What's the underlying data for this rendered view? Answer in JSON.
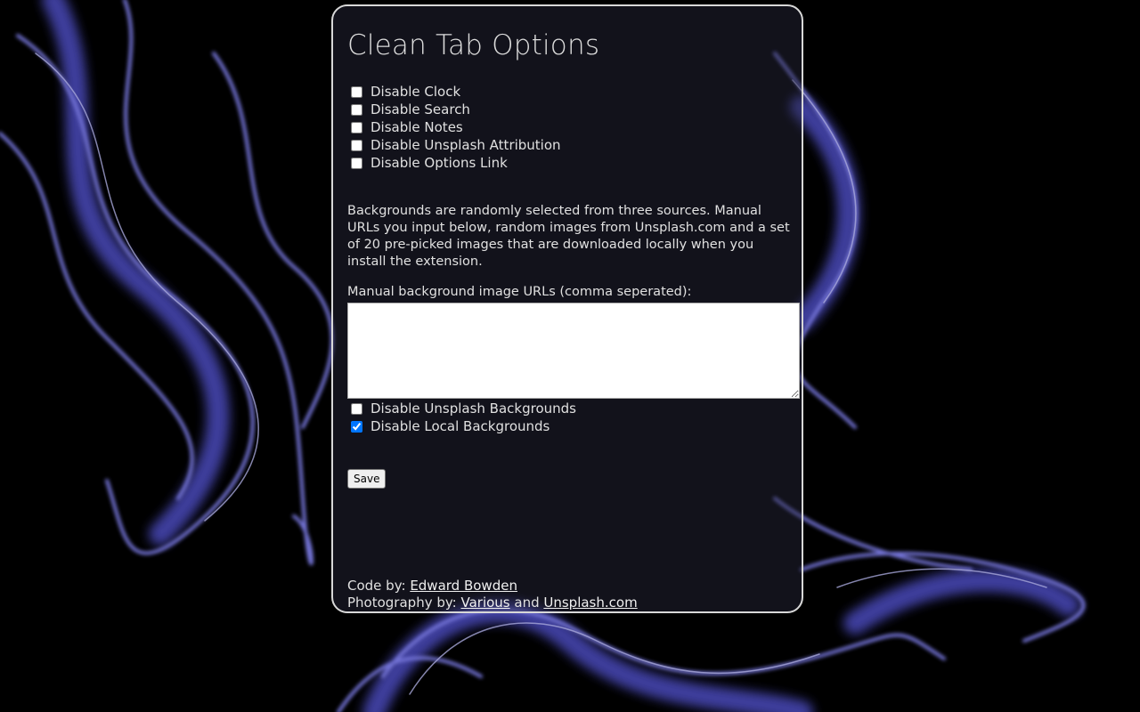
{
  "page": {
    "title": "Clean Tab Options"
  },
  "options": [
    {
      "label": "Disable Clock",
      "checked": false
    },
    {
      "label": "Disable Search",
      "checked": false
    },
    {
      "label": "Disable Notes",
      "checked": false
    },
    {
      "label": "Disable Unsplash Attribution",
      "checked": false
    },
    {
      "label": "Disable Options Link",
      "checked": false
    }
  ],
  "backgrounds": {
    "description": "Backgrounds are randomly selected from three sources. Manual URLs you input below, random images from Unsplash.com and a set of 20 pre-picked images that are downloaded locally when you install the extension.",
    "manual_label": "Manual background image URLs (comma seperated):",
    "manual_value": "",
    "disable_unsplash": {
      "label": "Disable Unsplash Backgrounds",
      "checked": false
    },
    "disable_local": {
      "label": "Disable Local Backgrounds",
      "checked": true
    }
  },
  "save_label": "Save",
  "credits": {
    "code_prefix": "Code by: ",
    "code_author": "Edward Bowden",
    "photo_prefix": "Photography by: ",
    "photo_various": "Various",
    "photo_and": " and ",
    "photo_unsplash": "Unsplash.com"
  },
  "colors": {
    "background": "#000000",
    "smoke": "#6a6ae0",
    "panel_border": "#d8d8d8",
    "text": "#e0e0e0"
  }
}
